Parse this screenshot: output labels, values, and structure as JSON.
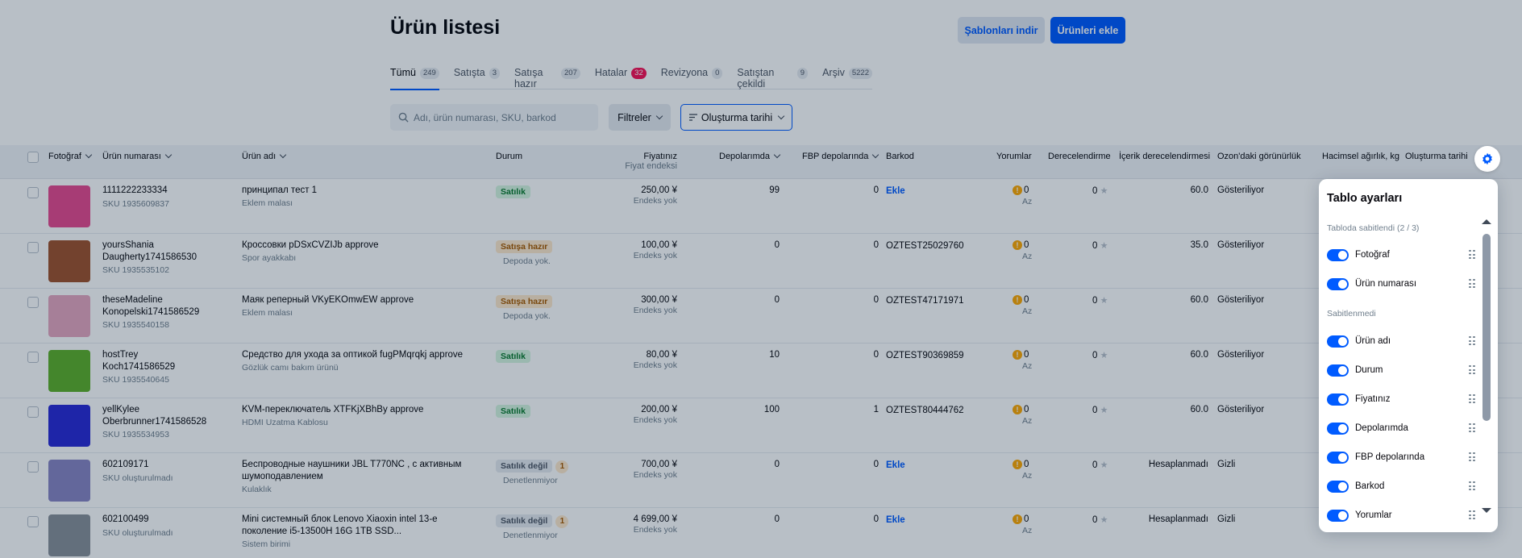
{
  "header": {
    "title": "Ürün listesi",
    "download_templates": "Şablonları indir",
    "add_products": "Ürünleri ekle"
  },
  "tabs": [
    {
      "label": "Tümü",
      "count": "249",
      "active": true
    },
    {
      "label": "Satışta",
      "count": "3"
    },
    {
      "label": "Satışa hazır",
      "count": "207"
    },
    {
      "label": "Hatalar",
      "count": "32"
    },
    {
      "label": "Revizyona",
      "count": "0"
    },
    {
      "label": "Satıştan çekildi",
      "count": "9"
    },
    {
      "label": "Arşiv",
      "count": "5222"
    }
  ],
  "toolbar": {
    "search_placeholder": "Adı, ürün numarası, SKU, barkod",
    "filters": "Filtreler",
    "sort": "Oluşturma tarihi"
  },
  "columns": {
    "photo": "Fotoğraf",
    "product_number": "Ürün numarası",
    "product_name": "Ürün adı",
    "status": "Durum",
    "price": "Fiyatınız",
    "price_sub": "Fiyat endeksi",
    "stock": "Depolarımda",
    "fbp": "FBP depolarında",
    "barcode": "Barkod",
    "reviews": "Yorumlar",
    "rating": "Derecelendirme",
    "content_rating": "İçerik derecelendirmesi",
    "visibility": "Ozon'daki görünürlük",
    "volume_weight": "Hacimsel ağırlık, kg",
    "created": "Oluşturma tarihi"
  },
  "rows": [
    {
      "number": "1111222233334",
      "number2": "",
      "sku": "SKU 1935609837",
      "name": "принципал тест 1",
      "name2": "",
      "category": "Eklem malası",
      "status": "Satılık",
      "status_sub": "",
      "status_count": "",
      "price": "250,00 ¥",
      "price_sub": "Endeks yok",
      "stock": "99",
      "fbp": "0",
      "barcode": "Ekle",
      "barcode_link": true,
      "reviews": "0",
      "reviews_sub": "Az",
      "rating": "0",
      "content": "60.0",
      "visibility": "Gösteriliyor"
    },
    {
      "number": "yoursShania",
      "number2": "Daugherty1741586530",
      "sku": "SKU 1935535102",
      "name": "Кроссовки pDSxCVZIJb approve",
      "name2": "",
      "category": "Spor ayakkabı",
      "status": "Satışa hazır",
      "status_sub": "Depoda yok.",
      "status_count": "",
      "price": "100,00 ¥",
      "price_sub": "Endeks yok",
      "stock": "0",
      "fbp": "0",
      "barcode": "OZTEST25029760",
      "barcode_link": false,
      "reviews": "0",
      "reviews_sub": "Az",
      "rating": "0",
      "content": "35.0",
      "visibility": "Gösteriliyor"
    },
    {
      "number": "theseMadeline",
      "number2": "Konopelski1741586529",
      "sku": "SKU 1935540158",
      "name": "Маяк реперный VKyEKOmwEW approve",
      "name2": "",
      "category": "Eklem malası",
      "status": "Satışa hazır",
      "status_sub": "Depoda yok.",
      "status_count": "",
      "price": "300,00 ¥",
      "price_sub": "Endeks yok",
      "stock": "0",
      "fbp": "0",
      "barcode": "OZTEST47171971",
      "barcode_link": false,
      "reviews": "0",
      "reviews_sub": "Az",
      "rating": "0",
      "content": "60.0",
      "visibility": "Gösteriliyor"
    },
    {
      "number": "hostTrey",
      "number2": "Koch1741586529",
      "sku": "SKU 1935540645",
      "name": "Средство для ухода за оптикой fugPMqrqkj approve",
      "name2": "",
      "category": "Gözlük camı bakım ürünü",
      "status": "Satılık",
      "status_sub": "",
      "status_count": "",
      "price": "80,00 ¥",
      "price_sub": "Endeks yok",
      "stock": "10",
      "fbp": "0",
      "barcode": "OZTEST90369859",
      "barcode_link": false,
      "reviews": "0",
      "reviews_sub": "Az",
      "rating": "0",
      "content": "60.0",
      "visibility": "Gösteriliyor"
    },
    {
      "number": "yellKylee",
      "number2": "Oberbrunner1741586528",
      "sku": "SKU 1935534953",
      "name": "KVM-переключатель XTFKjXBhBy approve",
      "name2": "",
      "category": "HDMI Uzatma Kablosu",
      "status": "Satılık",
      "status_sub": "",
      "status_count": "",
      "price": "200,00 ¥",
      "price_sub": "Endeks yok",
      "stock": "100",
      "fbp": "1",
      "barcode": "OZTEST80444762",
      "barcode_link": false,
      "reviews": "0",
      "reviews_sub": "Az",
      "rating": "0",
      "content": "60.0",
      "visibility": "Gösteriliyor"
    },
    {
      "number": "602109171",
      "number2": "",
      "sku": "SKU oluşturulmadı",
      "name": "Беспроводные наушники JBL T770NC , с активным",
      "name2": "шумоподавлением",
      "category": "Kulaklık",
      "status": "Satılık değil",
      "status_sub": "Denetlenmiyor",
      "status_count": "1",
      "price": "700,00 ¥",
      "price_sub": "Endeks yok",
      "stock": "0",
      "fbp": "0",
      "barcode": "Ekle",
      "barcode_link": true,
      "reviews": "0",
      "reviews_sub": "Az",
      "rating": "0",
      "content": "Hesaplanmadı",
      "visibility": "Gizli"
    },
    {
      "number": "602100499",
      "number2": "",
      "sku": "SKU oluşturulmadı",
      "name": "Mini системный блок Lenovo Xiaoxin intel 13-е",
      "name2": "поколение i5-13500H 16G 1TB SSD...",
      "category": "Sistem birimi",
      "status": "Satılık değil",
      "status_sub": "Denetlenmiyor",
      "status_count": "1",
      "price": "4 699,00 ¥",
      "price_sub": "Endeks yok",
      "stock": "0",
      "fbp": "0",
      "barcode": "Ekle",
      "barcode_link": true,
      "reviews": "0",
      "reviews_sub": "Az",
      "rating": "0",
      "content": "Hesaplanmadı",
      "visibility": "Gizli"
    }
  ],
  "thumb_colors": [
    "#e84a8f",
    "#a0522d",
    "#e7a7c0",
    "#5fb02a",
    "#2a2ad6",
    "#8a86c4",
    "#8a9099"
  ],
  "panel": {
    "title": "Tablo ayarları",
    "pinned_label": "Tabloda sabitlendi (2 / 3)",
    "unpinned_label": "Sabitlenmedi",
    "pinned": [
      "Fotoğraf",
      "Ürün numarası"
    ],
    "unpinned": [
      "Ürün adı",
      "Durum",
      "Fiyatınız",
      "Depolarımda",
      "FBP depolarında",
      "Barkod",
      "Yorumlar"
    ]
  },
  "colors": {
    "accent": "#005bff",
    "danger": "#f91155",
    "overlay": "rgba(0,26,52,0.28)"
  }
}
